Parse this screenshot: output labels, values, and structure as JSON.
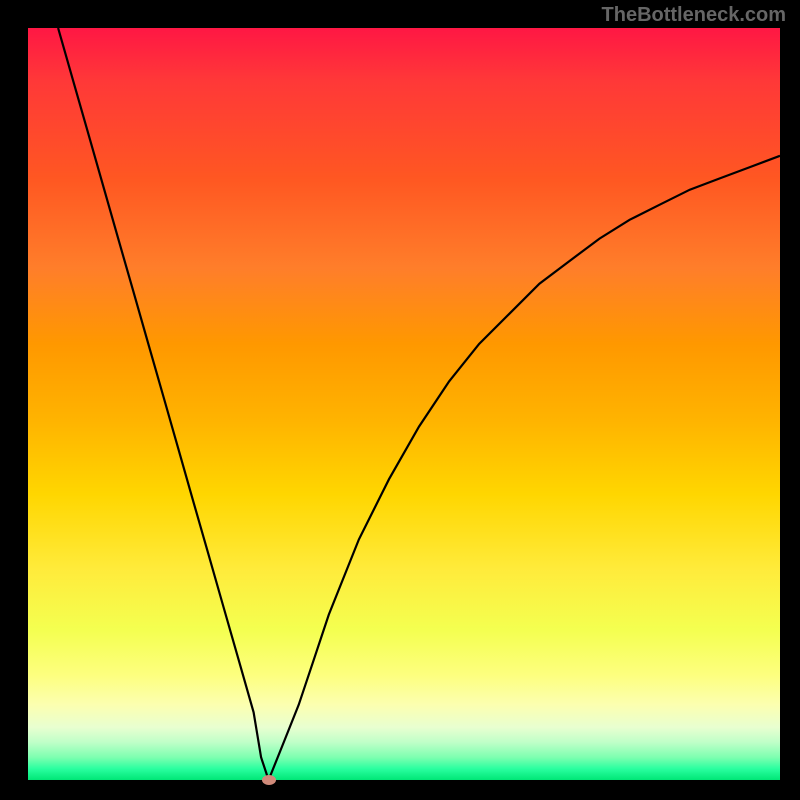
{
  "watermark": "TheBottleneck.com",
  "colors": {
    "gradient_top": "#ff1744",
    "gradient_mid": "#ffd600",
    "gradient_bottom": "#00e676",
    "curve": "#000000",
    "marker": "#d08a7a",
    "frame": "#000000"
  },
  "chart_data": {
    "type": "line",
    "title": "",
    "xlabel": "",
    "ylabel": "",
    "xlim": [
      0,
      100
    ],
    "ylim": [
      0,
      100
    ],
    "grid": false,
    "series": [
      {
        "name": "bottleneck_curve",
        "x": [
          4,
          6,
          8,
          10,
          12,
          14,
          16,
          18,
          20,
          22,
          24,
          26,
          28,
          30,
          31,
          32,
          34,
          36,
          38,
          40,
          44,
          48,
          52,
          56,
          60,
          64,
          68,
          72,
          76,
          80,
          84,
          88,
          92,
          96,
          100
        ],
        "y": [
          100,
          93,
          86,
          79,
          72,
          65,
          58,
          51,
          44,
          37,
          30,
          23,
          16,
          9,
          3,
          0,
          5,
          10,
          16,
          22,
          32,
          40,
          47,
          53,
          58,
          62,
          66,
          69,
          72,
          74.5,
          76.5,
          78.5,
          80,
          81.5,
          83
        ]
      }
    ],
    "marker": {
      "x": 32,
      "y": 0
    },
    "background_scale": {
      "0": "#00e676",
      "50": "#ffd600",
      "100": "#ff1744"
    }
  }
}
